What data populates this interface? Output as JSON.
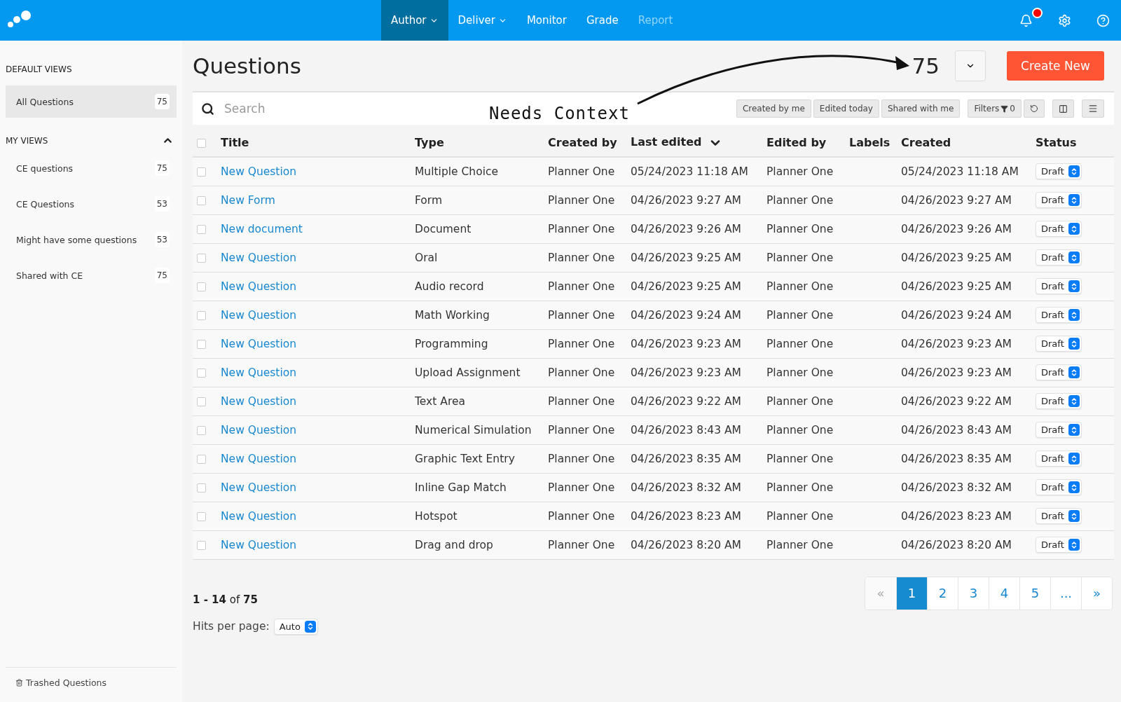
{
  "nav": {
    "items": [
      {
        "label": "Author",
        "selected": true,
        "disabled": false,
        "has_menu": true
      },
      {
        "label": "Deliver",
        "selected": false,
        "disabled": false,
        "has_menu": true
      },
      {
        "label": "Monitor",
        "selected": false,
        "disabled": false,
        "has_menu": false
      },
      {
        "label": "Grade",
        "selected": false,
        "disabled": false,
        "has_menu": false
      },
      {
        "label": "Report",
        "selected": false,
        "disabled": true,
        "has_menu": false
      }
    ],
    "notifications": {
      "unread": true
    }
  },
  "sidebar": {
    "default_views": {
      "heading": "DEFAULT VIEWS",
      "items": [
        {
          "label": "All Questions",
          "count": "75",
          "selected": true
        }
      ]
    },
    "my_views": {
      "heading": "MY VIEWS",
      "expanded": true,
      "items": [
        {
          "label": "CE questions",
          "count": "75",
          "selected": false
        },
        {
          "label": "CE Questions",
          "count": "53",
          "selected": false
        },
        {
          "label": "Might have some questions",
          "count": "53",
          "selected": false
        },
        {
          "label": "Shared with CE",
          "count": "75",
          "selected": false
        }
      ]
    },
    "trash": {
      "label": "Trashed Questions"
    }
  },
  "header": {
    "title": "Questions",
    "total": "75",
    "create_button": "Create New"
  },
  "annotation": {
    "text": "Needs Context"
  },
  "toolbar": {
    "search_placeholder": "Search",
    "quick_filters": [
      "Created by me",
      "Edited today",
      "Shared with me"
    ],
    "filters": {
      "label": "Filters",
      "count": "0"
    }
  },
  "table": {
    "select_all": {
      "checked": false
    },
    "columns": [
      {
        "label": "Title",
        "sorted": false
      },
      {
        "label": "Type",
        "sorted": false
      },
      {
        "label": "Created by",
        "sorted": false
      },
      {
        "label": "Last edited",
        "sorted": true
      },
      {
        "label": "Edited by",
        "sorted": false
      },
      {
        "label": "Labels",
        "sorted": false
      },
      {
        "label": "Created",
        "sorted": false
      },
      {
        "label": "Status",
        "sorted": false
      }
    ],
    "rows": [
      {
        "checked": false,
        "title": "New Question",
        "type": "Multiple Choice",
        "created_by": "Planner One",
        "last_edited": "05/24/2023 11:18 AM",
        "edited_by": "Planner One",
        "created": "05/24/2023 11:18 AM",
        "status": "Draft"
      },
      {
        "checked": false,
        "title": "New Form",
        "type": "Form",
        "created_by": "Planner One",
        "last_edited": "04/26/2023 9:27 AM",
        "edited_by": "Planner One",
        "created": "04/26/2023 9:27 AM",
        "status": "Draft"
      },
      {
        "checked": false,
        "title": "New document",
        "type": "Document",
        "created_by": "Planner One",
        "last_edited": "04/26/2023 9:26 AM",
        "edited_by": "Planner One",
        "created": "04/26/2023 9:26 AM",
        "status": "Draft"
      },
      {
        "checked": false,
        "title": "New Question",
        "type": "Oral",
        "created_by": "Planner One",
        "last_edited": "04/26/2023 9:25 AM",
        "edited_by": "Planner One",
        "created": "04/26/2023 9:25 AM",
        "status": "Draft"
      },
      {
        "checked": false,
        "title": "New Question",
        "type": "Audio record",
        "created_by": "Planner One",
        "last_edited": "04/26/2023 9:25 AM",
        "edited_by": "Planner One",
        "created": "04/26/2023 9:25 AM",
        "status": "Draft"
      },
      {
        "checked": false,
        "title": "New Question",
        "type": "Math Working",
        "created_by": "Planner One",
        "last_edited": "04/26/2023 9:24 AM",
        "edited_by": "Planner One",
        "created": "04/26/2023 9:24 AM",
        "status": "Draft"
      },
      {
        "checked": false,
        "title": "New Question",
        "type": "Programming",
        "created_by": "Planner One",
        "last_edited": "04/26/2023 9:23 AM",
        "edited_by": "Planner One",
        "created": "04/26/2023 9:23 AM",
        "status": "Draft"
      },
      {
        "checked": false,
        "title": "New Question",
        "type": "Upload Assignment",
        "created_by": "Planner One",
        "last_edited": "04/26/2023 9:23 AM",
        "edited_by": "Planner One",
        "created": "04/26/2023 9:23 AM",
        "status": "Draft"
      },
      {
        "checked": false,
        "title": "New Question",
        "type": "Text Area",
        "created_by": "Planner One",
        "last_edited": "04/26/2023 9:22 AM",
        "edited_by": "Planner One",
        "created": "04/26/2023 9:22 AM",
        "status": "Draft"
      },
      {
        "checked": false,
        "title": "New Question",
        "type": "Numerical Simulation",
        "created_by": "Planner One",
        "last_edited": "04/26/2023 8:43 AM",
        "edited_by": "Planner One",
        "created": "04/26/2023 8:43 AM",
        "status": "Draft"
      },
      {
        "checked": false,
        "title": "New Question",
        "type": "Graphic Text Entry",
        "created_by": "Planner One",
        "last_edited": "04/26/2023 8:35 AM",
        "edited_by": "Planner One",
        "created": "04/26/2023 8:35 AM",
        "status": "Draft"
      },
      {
        "checked": false,
        "title": "New Question",
        "type": "Inline Gap Match",
        "created_by": "Planner One",
        "last_edited": "04/26/2023 8:32 AM",
        "edited_by": "Planner One",
        "created": "04/26/2023 8:32 AM",
        "status": "Draft"
      },
      {
        "checked": false,
        "title": "New Question",
        "type": "Hotspot",
        "created_by": "Planner One",
        "last_edited": "04/26/2023 8:23 AM",
        "edited_by": "Planner One",
        "created": "04/26/2023 8:23 AM",
        "status": "Draft"
      },
      {
        "checked": false,
        "title": "New Question",
        "type": "Drag and drop",
        "created_by": "Planner One",
        "last_edited": "04/26/2023 8:20 AM",
        "edited_by": "Planner One",
        "created": "04/26/2023 8:20 AM",
        "status": "Draft"
      }
    ]
  },
  "footer": {
    "range": "**1 - 14** of **75**",
    "hits_label": "Hits per page:",
    "hits_value": "Auto",
    "pages": [
      {
        "label": "«",
        "selected": false,
        "disabled": true
      },
      {
        "label": "1",
        "selected": true,
        "disabled": false
      },
      {
        "label": "2",
        "selected": false,
        "disabled": false
      },
      {
        "label": "3",
        "selected": false,
        "disabled": false
      },
      {
        "label": "4",
        "selected": false,
        "disabled": false
      },
      {
        "label": "5",
        "selected": false,
        "disabled": false
      },
      {
        "label": "...",
        "selected": false,
        "disabled": false
      },
      {
        "label": "»",
        "selected": false,
        "disabled": false
      }
    ]
  }
}
